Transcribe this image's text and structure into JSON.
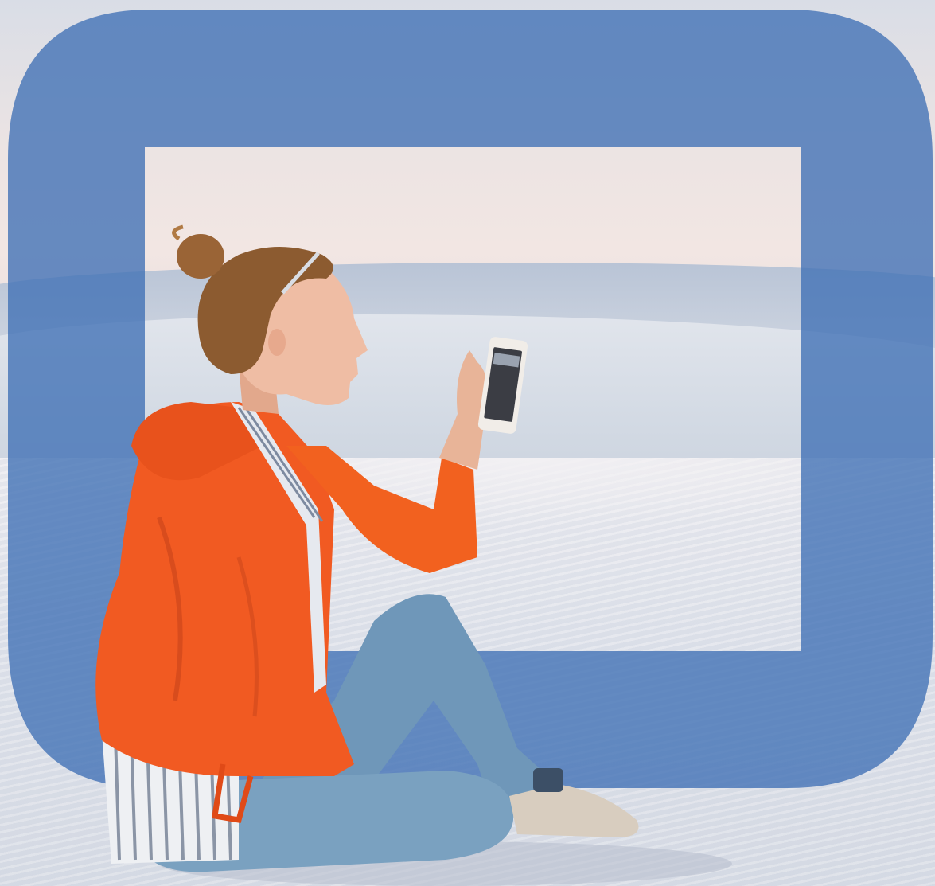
{
  "image": {
    "description_free": true
  },
  "colors": {
    "frame_blue": "#3f72b8",
    "jacket_orange": "#f0571f",
    "jeans_blue": "#6e96b8",
    "skin": "#e9b69c",
    "hair": "#8a5a32",
    "phone": "#f2f2f2"
  },
  "icons": [
    "rounded-square-frame-icon"
  ]
}
